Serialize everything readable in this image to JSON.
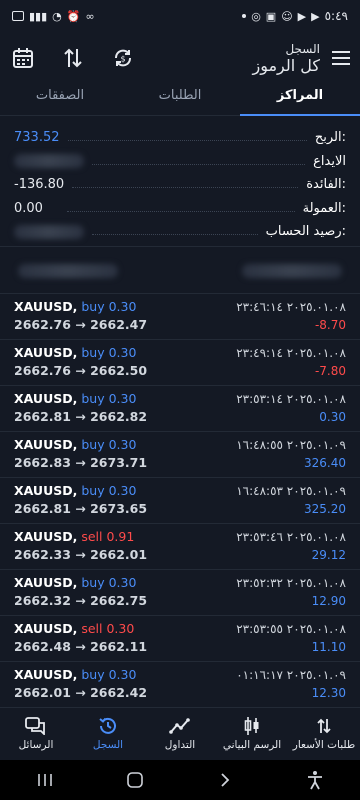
{
  "status_bar": {
    "time": "٥:٤٩"
  },
  "header": {
    "subtitle": "السجل",
    "title": "كل الرموز"
  },
  "tabs": [
    {
      "label": "الصفقات"
    },
    {
      "label": "الطلبات"
    },
    {
      "label": "المراكز"
    }
  ],
  "summary": {
    "profit_label": "الربح:",
    "profit_value": "733.52",
    "deposit_label": "الايداع",
    "interest_label": "الفائدة:",
    "interest_value": "-136.80",
    "commission_label": "العمولة:",
    "commission_value": "0.00",
    "balance_label": "رصيد الحساب:"
  },
  "trades": [
    {
      "symbol": "XAUUSD,",
      "side": "buy",
      "volume": "0.30",
      "side_type": "buy",
      "prices": "2662.76 → 2662.47",
      "date": "٢٠٢٥.٠١.٠٨ ٢٣:٤٦:١٤",
      "profit": "-8.70",
      "profit_type": "neg"
    },
    {
      "symbol": "XAUUSD,",
      "side": "buy",
      "volume": "0.30",
      "side_type": "buy",
      "prices": "2662.76 → 2662.50",
      "date": "٢٠٢٥.٠١.٠٨ ٢٣:٤٩:١٤",
      "profit": "-7.80",
      "profit_type": "neg"
    },
    {
      "symbol": "XAUUSD,",
      "side": "buy",
      "volume": "0.30",
      "side_type": "buy",
      "prices": "2662.81 → 2662.82",
      "date": "٢٠٢٥.٠١.٠٨ ٢٣:٥٣:١٤",
      "profit": "0.30",
      "profit_type": "pos"
    },
    {
      "symbol": "XAUUSD,",
      "side": "buy",
      "volume": "0.30",
      "side_type": "buy",
      "prices": "2662.83 → 2673.71",
      "date": "٢٠٢٥.٠١.٠٩ ١٦:٤٨:٥٥",
      "profit": "326.40",
      "profit_type": "pos"
    },
    {
      "symbol": "XAUUSD,",
      "side": "buy",
      "volume": "0.30",
      "side_type": "buy",
      "prices": "2662.81 → 2673.65",
      "date": "٢٠٢٥.٠١.٠٩ ١٦:٤٨:٥٣",
      "profit": "325.20",
      "profit_type": "pos"
    },
    {
      "symbol": "XAUUSD,",
      "side": "sell",
      "volume": "0.91",
      "side_type": "sell",
      "prices": "2662.33 → 2662.01",
      "date": "٢٠٢٥.٠١.٠٨ ٢٣:٥٣:٤٦",
      "profit": "29.12",
      "profit_type": "pos"
    },
    {
      "symbol": "XAUUSD,",
      "side": "buy",
      "volume": "0.30",
      "side_type": "buy",
      "prices": "2662.32 → 2662.75",
      "date": "٢٠٢٥.٠١.٠٨ ٢٣:٥٢:٣٢",
      "profit": "12.90",
      "profit_type": "pos"
    },
    {
      "symbol": "XAUUSD,",
      "side": "sell",
      "volume": "0.30",
      "side_type": "sell",
      "prices": "2662.48 → 2662.11",
      "date": "٢٠٢٥.٠١.٠٨ ٢٣:٥٣:٥٥",
      "profit": "11.10",
      "profit_type": "pos"
    },
    {
      "symbol": "XAUUSD,",
      "side": "buy",
      "volume": "0.30",
      "side_type": "buy",
      "prices": "2662.01 → 2662.42",
      "date": "٢٠٢٥.٠١.٠٩ ٠١:١٦:١٧",
      "profit": "12.30",
      "profit_type": "pos"
    }
  ],
  "bottom_nav": [
    {
      "label": "الرسائل",
      "icon": "messages-icon"
    },
    {
      "label": "السجل",
      "icon": "history-icon"
    },
    {
      "label": "التداول",
      "icon": "trade-icon"
    },
    {
      "label": "الرسم البياني",
      "icon": "chart-icon"
    },
    {
      "label": "طلبات الأسعار",
      "icon": "quotes-icon"
    }
  ],
  "colors": {
    "background": "#141924",
    "accent": "#4a8df8",
    "negative": "#ff4b4b"
  }
}
